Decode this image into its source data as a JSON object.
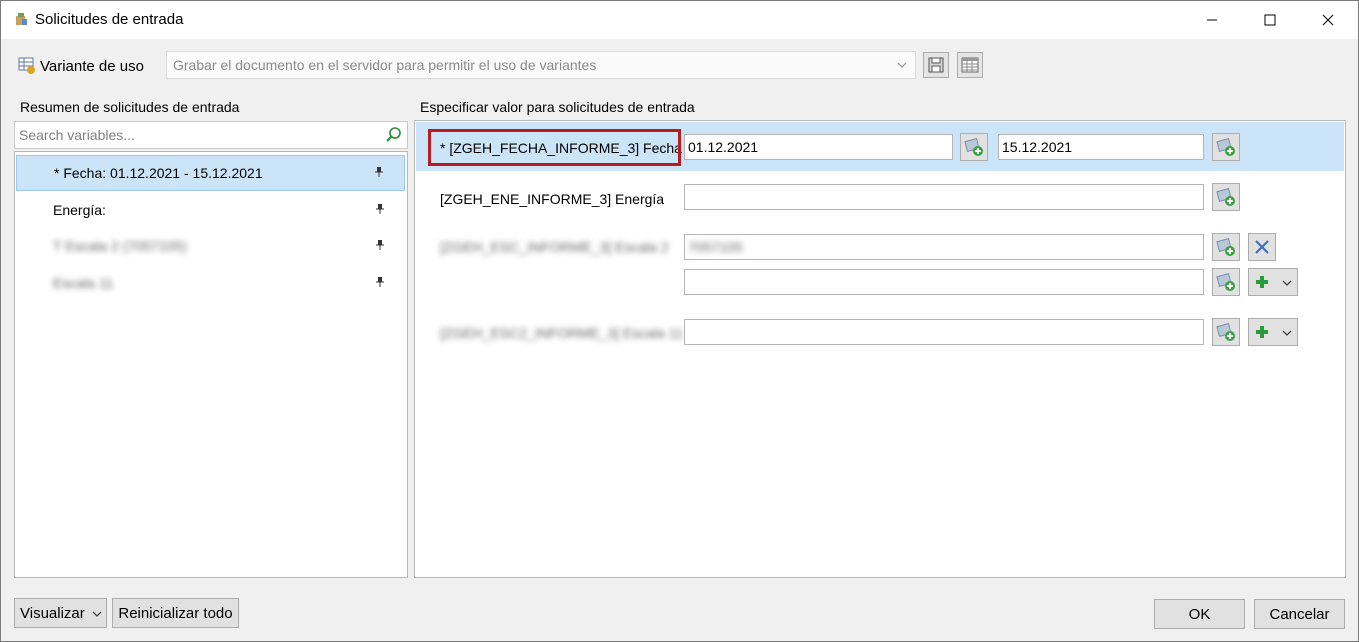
{
  "window": {
    "title": "Solicitudes de entrada"
  },
  "variant": {
    "label": "Variante de uso",
    "placeholder": "Grabar el documento en el servidor para permitir el uso de variantes"
  },
  "left_panel": {
    "heading": "Resumen de solicitudes de entrada",
    "search_placeholder": "Search variables...",
    "items": [
      {
        "label": "* Fecha: 01.12.2021 - 15.12.2021",
        "selected": true
      },
      {
        "label": "Energía:",
        "selected": false
      },
      {
        "label": "T Escala 2 (7057105)",
        "selected": false
      },
      {
        "label": "Escala 11",
        "selected": false
      }
    ]
  },
  "right_panel": {
    "heading": "Especificar valor para solicitudes de entrada",
    "rows": [
      {
        "label": "* [ZGEH_FECHA_INFORME_3] Fecha",
        "from": "01.12.2021",
        "to": "15.12.2021"
      },
      {
        "label": "[ZGEH_ENE_INFORME_3] Energía",
        "value": ""
      },
      {
        "label": "[ZGEH_ESC_INFORME_3] Escala 2",
        "value": "7057105",
        "value2": ""
      },
      {
        "label": "[ZGEH_ESC2_INFORME_3] Escala 11",
        "value": ""
      }
    ]
  },
  "footer": {
    "visualize": "Visualizar",
    "reset": "Reinicializar todo",
    "ok": "OK",
    "cancel": "Cancelar"
  },
  "colors": {
    "selection": "#cce4f7",
    "highlight_border": "#b81c22"
  }
}
